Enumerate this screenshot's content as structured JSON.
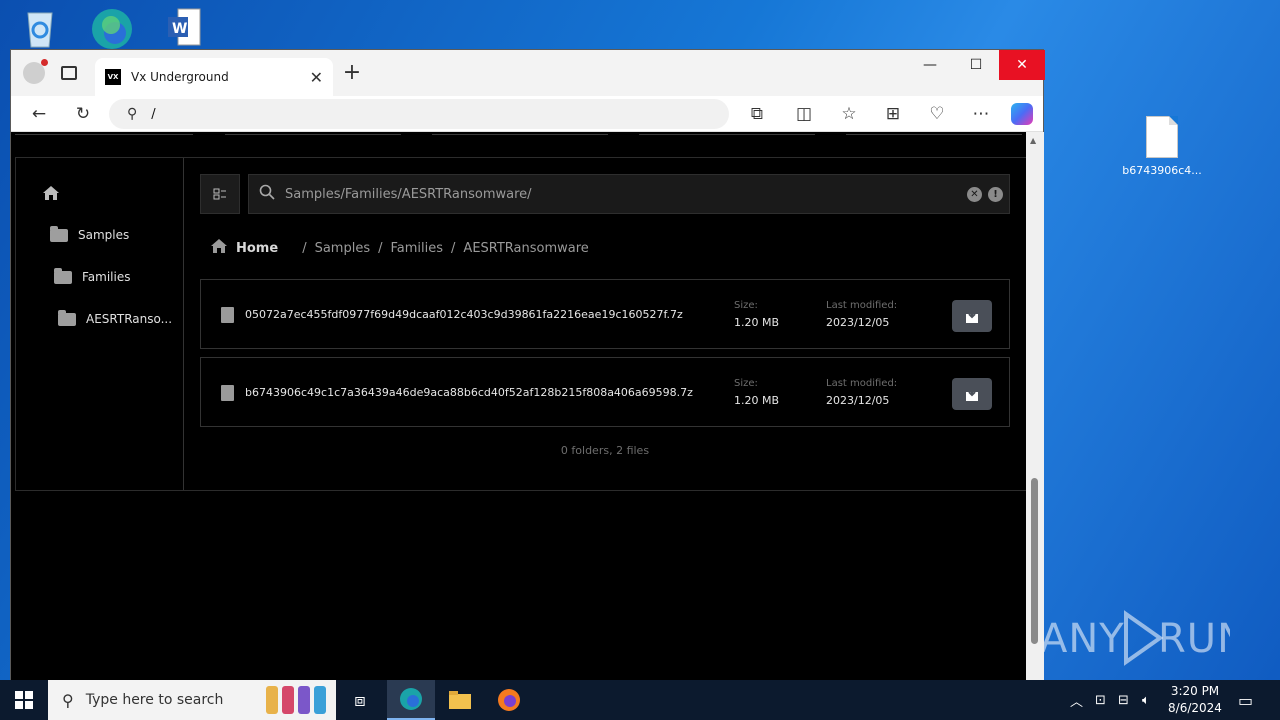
{
  "desktop": {
    "file_label": "b6743906c4...",
    "watermark": "ANY RUN"
  },
  "browser": {
    "tab_title": "Vx Underground",
    "favicon_text": "VX",
    "address": "/",
    "new_tab": "+",
    "close_tab": "✕"
  },
  "sidebar": {
    "items": [
      {
        "label": "Samples"
      },
      {
        "label": "Families"
      },
      {
        "label": "AESRTRanso..."
      }
    ]
  },
  "search": {
    "value": "Samples/Families/AESRTRansomware/"
  },
  "breadcrumb": {
    "home": "Home",
    "parts": [
      "Samples",
      "Families",
      "AESRTRansomware"
    ],
    "sep": "/"
  },
  "files": [
    {
      "name": "05072a7ec455fdf0977f69d49dcaaf012c403c9d39861fa2216eae19c160527f.7z",
      "size_label": "Size:",
      "size": "1.20 MB",
      "modified_label": "Last modified:",
      "modified": "2023/12/05"
    },
    {
      "name": "b6743906c49c1c7a36439a46de9aca88b6cd40f52af128b215f808a406a69598.7z",
      "size_label": "Size:",
      "size": "1.20 MB",
      "modified_label": "Last modified:",
      "modified": "2023/12/05"
    }
  ],
  "summary": "0 folders, 2 files",
  "taskbar": {
    "search_placeholder": "Type here to search",
    "time": "3:20 PM",
    "date": "8/6/2024"
  },
  "colors": {
    "accent_close": "#e81123",
    "download_button": "#4a4f58"
  }
}
